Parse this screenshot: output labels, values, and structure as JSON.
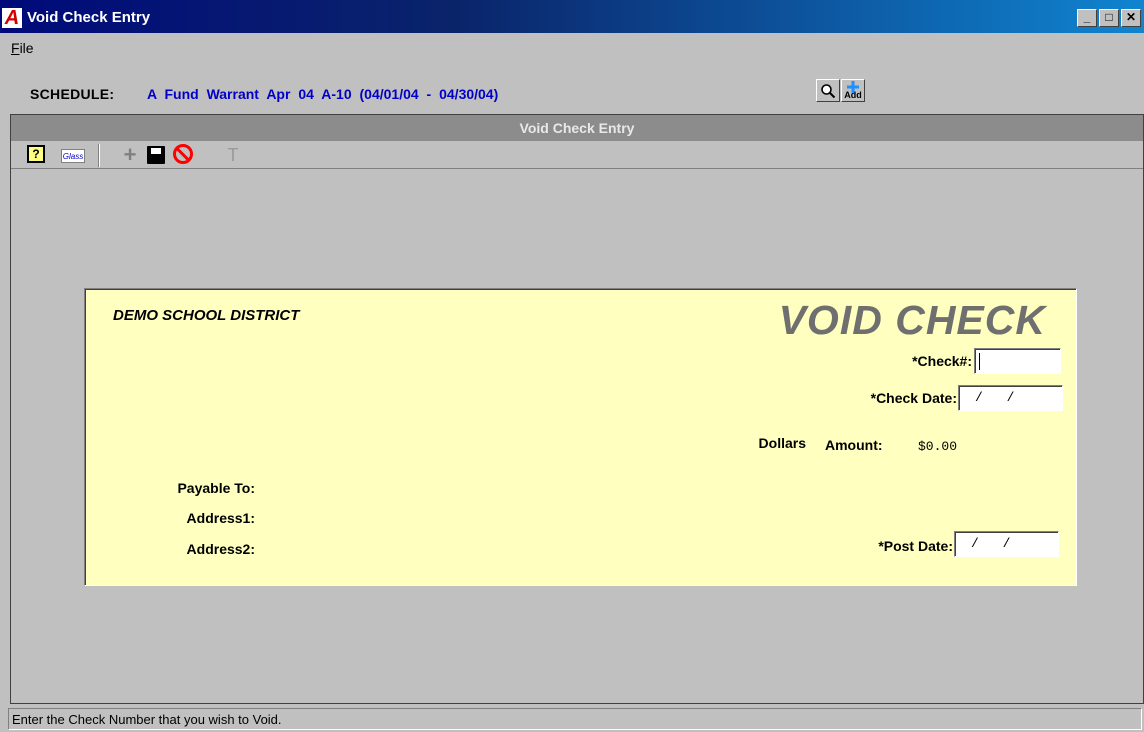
{
  "window": {
    "title": "Void Check Entry",
    "logo_letter": "A",
    "minimize": "_",
    "maximize": "□",
    "close": "✕"
  },
  "menu": {
    "file_accel": "F",
    "file_rest": "ile"
  },
  "schedule": {
    "label": "SCHEDULE:",
    "value": "A Fund Warrant Apr 04   A-10   (04/01/04 - 04/30/04)",
    "add_label": "Add"
  },
  "form_header": "Void Check Entry",
  "toolbar": {
    "help": "?",
    "glass": "Glass",
    "plus": "+",
    "filter": "T"
  },
  "check": {
    "district": "DEMO SCHOOL DISTRICT",
    "title": "VOID CHECK",
    "check_no_label": "*Check#:",
    "check_no_value": "",
    "check_date_label": "*Check Date:",
    "check_date_value": "/ /",
    "dollars_label": "Dollars",
    "amount_label": "Amount:",
    "amount_value": "$0.00",
    "payable_label": "Payable To:",
    "address1_label": "Address1:",
    "address2_label": "Address2:",
    "post_date_label": "*Post Date:",
    "post_date_value": "/ /"
  },
  "status": "Enter the Check Number that you wish to Void.",
  "colors": {
    "check_background": "#ffffc0",
    "schedule_text": "#0000c8",
    "void_title": "#6f6f6f"
  }
}
